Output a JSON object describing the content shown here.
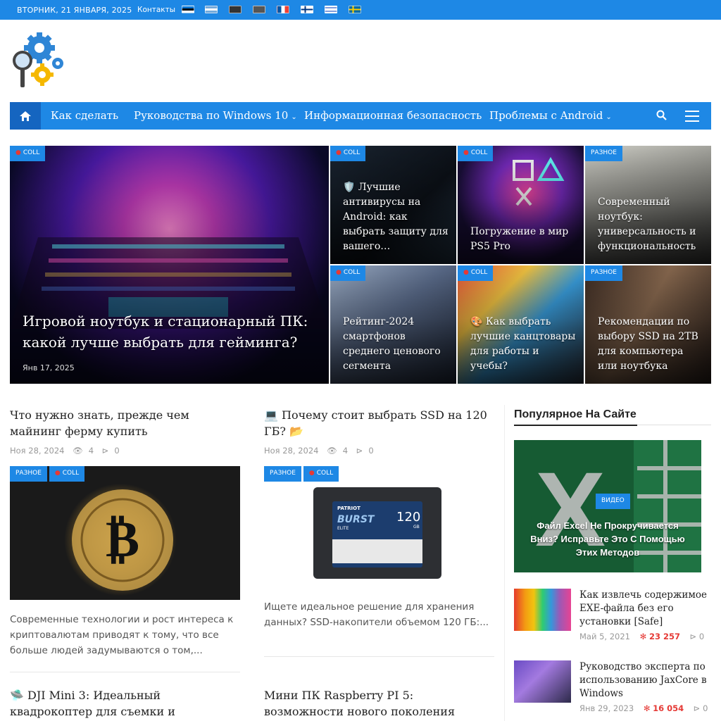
{
  "topbar": {
    "date": "ВТОРНИК, 21 ЯНВАРЯ, 2025",
    "contacts": "Контакты",
    "flags": [
      "flag-ee",
      "flag-ar",
      "flag-ag",
      "flag-us",
      "flag-fr",
      "flag-fi",
      "flag-il",
      "flag-se"
    ]
  },
  "nav": {
    "home": "home-icon",
    "items": [
      {
        "label": "Как сделать",
        "dropdown": false
      },
      {
        "label": "Руководства по Windows 10",
        "dropdown": true
      },
      {
        "label": "Информационная безопасность",
        "dropdown": false
      },
      {
        "label": "Проблемы с Android",
        "dropdown": true
      }
    ]
  },
  "hero": {
    "big": {
      "badge": "COLL",
      "title": "Игровой ноутбук и стационарный ПК: какой лучше выбрать для гейминга?",
      "date": "Янв 17, 2025"
    },
    "tiles": [
      {
        "badge": "COLL",
        "title": "🛡️ Лучшие антивирусы на Android: как выбрать защиту для вашего…"
      },
      {
        "badge": "COLL",
        "title": "Погружение в мир PS5 Pro"
      },
      {
        "badge": "РАЗНОЕ",
        "title": "Современный ноутбук: универсальность и функциональность"
      },
      {
        "badge": "COLL",
        "title": "Рейтинг-2024 смартфонов среднего ценового сегмента"
      },
      {
        "badge": "COLL",
        "title": "🎨 Как выбрать лучшие канцтовары для работы и учебы?"
      },
      {
        "badge": "РАЗНОЕ",
        "title": "Рекомендации по выбору SSD на 2TB для компьютера или ноутбука"
      }
    ]
  },
  "posts": [
    {
      "title": "Что нужно знать, прежде чем майнинг ферму купить",
      "date": "Ноя 28, 2024",
      "views": "4",
      "shares": "0",
      "badges": [
        "РАЗНОЕ",
        "COLL"
      ],
      "excerpt": "Современные технологии и рост интереса к криптовалютам приводят к тому, что все больше людей задумываются о том,..."
    },
    {
      "title": "💻 Почему стоит выбрать SSD на 120 ГБ? 📂",
      "date": "Ноя 28, 2024",
      "views": "4",
      "shares": "0",
      "badges": [
        "РАЗНОЕ",
        "COLL"
      ],
      "excerpt": "Ищете идеальное решение для хранения данных? SSD-накопители объемом 120 ГБ:..."
    },
    {
      "title": "🛸 DJI Mini 3: Идеальный квадрокоптер для съемки и"
    },
    {
      "title": "Мини ПК Raspberry PI 5: возможности нового поколения"
    }
  ],
  "ssd": {
    "brand": "PATRIOT",
    "model": "BURST",
    "sub": "ELITE",
    "cap": "120",
    "unit": "GB"
  },
  "sidebar": {
    "heading": "Популярное На Сайте",
    "featured": {
      "badge": "ВИДЕО",
      "title": "Файл Excel Не Прокручивается Вниз? Исправьте Это С Помощью Этих Методов"
    },
    "items": [
      {
        "title": "Как извлечь содержимое EXE-файла без его установки [Safe]",
        "date": "Май 5, 2021",
        "hits": "23 257",
        "shares": "0"
      },
      {
        "title": "Руководство эксперта по использованию JaxCore в Windows",
        "date": "Янв 29, 2023",
        "hits": "16 054",
        "shares": "0"
      }
    ]
  }
}
